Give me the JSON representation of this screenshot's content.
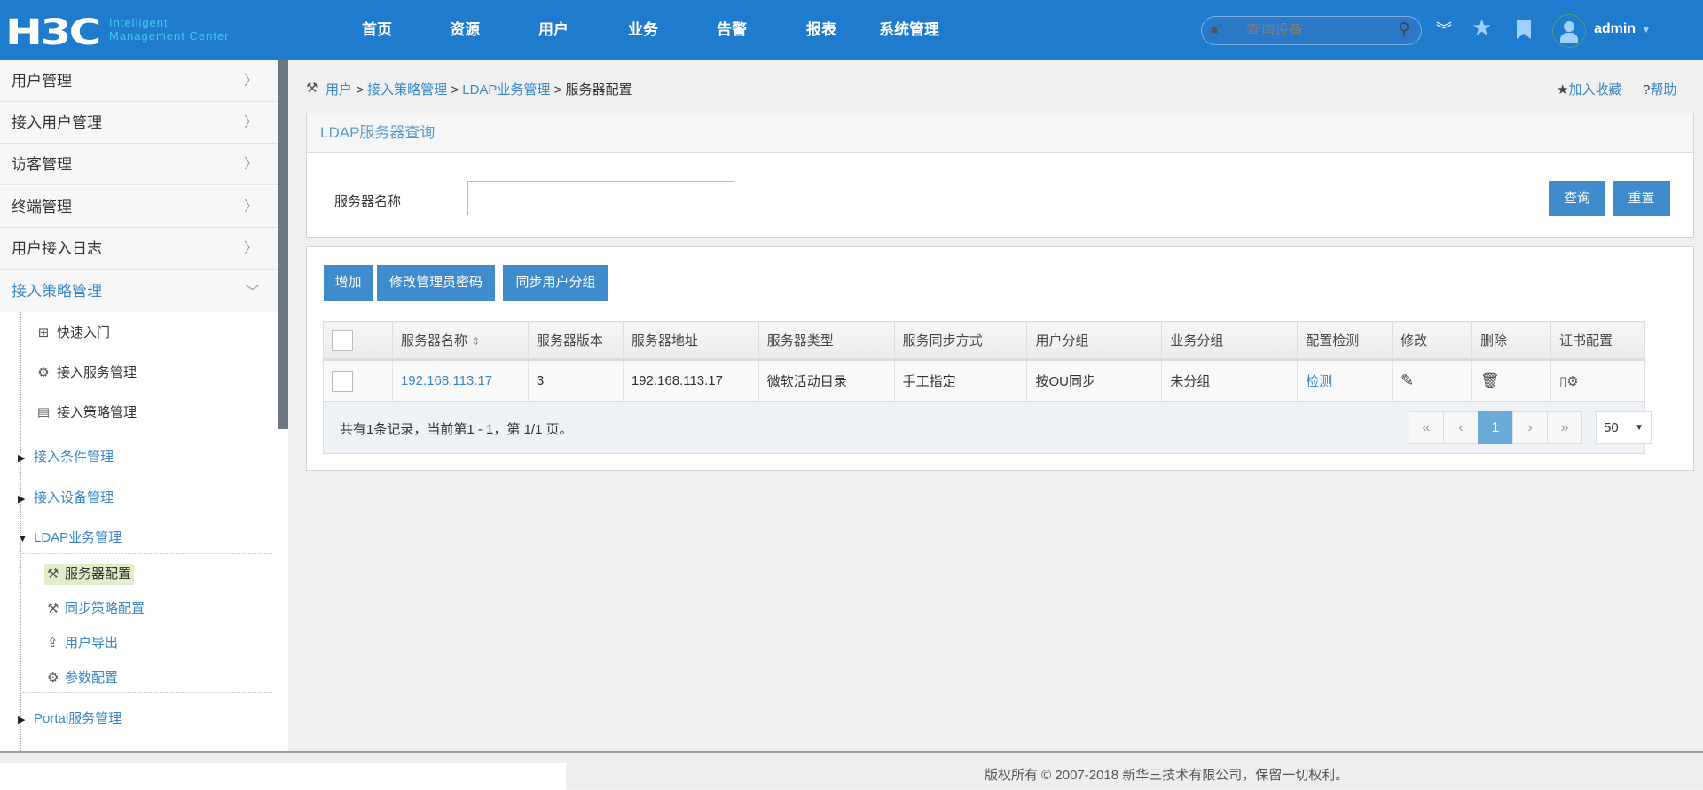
{
  "header": {
    "logo": "H3C",
    "logo_sub_line1": "Intelligent",
    "logo_sub_line2": "Management Center",
    "nav": [
      "首页",
      "资源",
      "用户",
      "业务",
      "告警",
      "报表",
      "系统管理"
    ],
    "search_placeholder": "查询设备",
    "user": "admin"
  },
  "sidebar": {
    "menus": [
      "用户管理",
      "接入用户管理",
      "访客管理",
      "终端管理",
      "用户接入日志",
      "接入策略管理"
    ],
    "sub_items": [
      "快速入门",
      "接入服务管理",
      "接入策略管理"
    ],
    "groups": [
      "接入条件管理",
      "接入设备管理",
      "LDAP业务管理"
    ],
    "ldap_items": [
      "服务器配置",
      "同步策略配置",
      "用户导出",
      "参数配置"
    ],
    "portal": "Portal服务管理"
  },
  "breadcrumb": [
    "用户",
    "接入策略管理",
    "LDAP业务管理",
    "服务器配置"
  ],
  "breadcrumb_sep": ">",
  "top_actions": {
    "favorite": "加入收藏",
    "help": "帮助"
  },
  "query_panel": {
    "title": "LDAP服务器查询",
    "field_label": "服务器名称",
    "field_value": "",
    "query_btn": "查询",
    "reset_btn": "重置"
  },
  "toolbar": {
    "add": "增加",
    "change_pwd": "修改管理员密码",
    "sync_groups": "同步用户分组"
  },
  "table": {
    "columns": [
      "服务器名称",
      "服务器版本",
      "服务器地址",
      "服务器类型",
      "服务同步方式",
      "用户分组",
      "业务分组",
      "配置检测",
      "修改",
      "删除",
      "证书配置"
    ],
    "rows": [
      {
        "name": "192.168.113.17",
        "version": "3",
        "address": "192.168.113.17",
        "type": "微软活动目录",
        "sync": "手工指定",
        "user_group": "按OU同步",
        "biz_group": "未分组",
        "check": "检测"
      }
    ]
  },
  "pager": {
    "summary": "共有1条记录，当前第1 - 1，第 1/1 页。",
    "first": "«",
    "prev": "‹",
    "current": "1",
    "next": "›",
    "last": "»",
    "page_size": "50"
  },
  "footer": {
    "copyright": "版权所有 © 2007-2018 新华三技术有限公司，保留一切权利。"
  },
  "colors": {
    "header": "#1f7bcd",
    "accent": "#3f8bcb",
    "link": "#3a86c8"
  }
}
